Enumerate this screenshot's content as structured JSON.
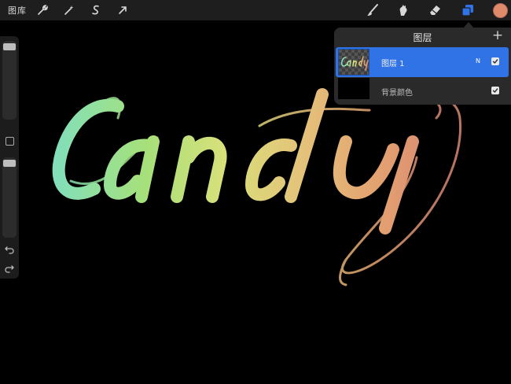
{
  "toolbar": {
    "gallery_label": "图库",
    "left_tools": [
      "wrench-icon",
      "magic-wand-icon",
      "selection-icon",
      "transform-icon"
    ],
    "right_tools": [
      "brush-icon",
      "smudge-icon",
      "eraser-icon",
      "layers-icon"
    ],
    "active_tool": "layers-icon",
    "current_color": "#e08a6c"
  },
  "sidebar": {
    "brush_size_level": 0.95,
    "opacity_level": 0.95,
    "icons": [
      "modify-button",
      "undo-icon",
      "redo-icon"
    ]
  },
  "canvas": {
    "background_color": "#000000",
    "lettering": "Candy",
    "gradient_colors": [
      "#7fdfc0",
      "#a6e07a",
      "#d8e07a",
      "#e4c27a",
      "#e3a070",
      "#d88a72"
    ]
  },
  "layers_panel": {
    "title": "图层",
    "add_label": "+",
    "layers": [
      {
        "name": "图层 1",
        "blend_mode": "N",
        "visible": true,
        "selected": true
      },
      {
        "name": "背景颜色",
        "blend_mode": "",
        "visible": true,
        "selected": false
      }
    ]
  }
}
